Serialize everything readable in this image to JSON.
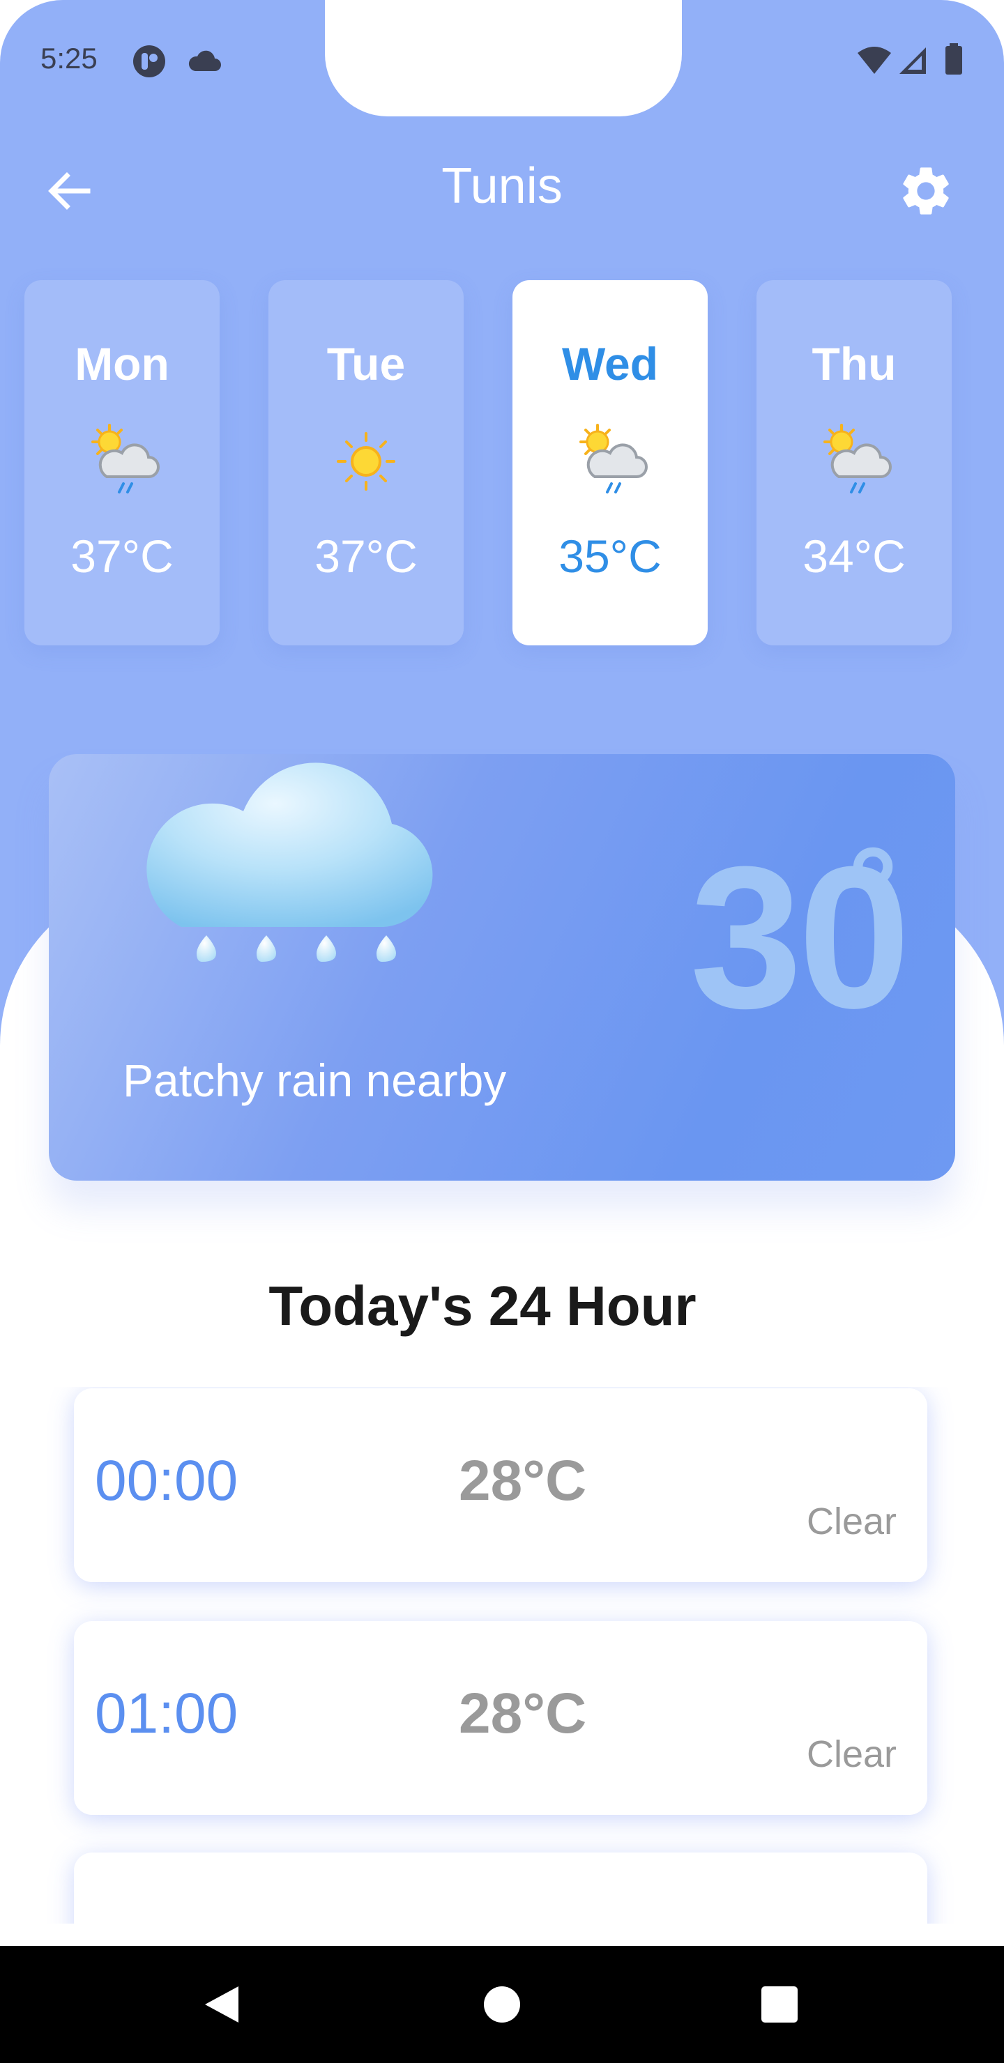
{
  "status_bar": {
    "time": "5:25",
    "left_icons": [
      "app-badge-icon",
      "cloud-icon"
    ],
    "right_icons": [
      "wifi-icon",
      "cellular-icon",
      "battery-icon"
    ]
  },
  "header": {
    "title": "Tunis",
    "back_icon": "arrow-left-icon",
    "settings_icon": "gear-icon"
  },
  "days": [
    {
      "day": "Mon",
      "temp": "37°C",
      "icon": "sun-cloud-rain-icon",
      "selected": false
    },
    {
      "day": "Tue",
      "temp": "37°C",
      "icon": "sun-icon",
      "selected": false
    },
    {
      "day": "Wed",
      "temp": "35°C",
      "icon": "sun-cloud-rain-icon",
      "selected": true
    },
    {
      "day": "Thu",
      "temp": "34°C",
      "icon": "sun-cloud-rain-icon",
      "selected": false
    }
  ],
  "current": {
    "temp": "30",
    "degree_symbol": "°",
    "condition": "Patchy rain nearby",
    "icon": "rain-cloud-icon"
  },
  "hourly": {
    "title": "Today's 24 Hour",
    "items": [
      {
        "time": "00:00",
        "temp": "28°C",
        "condition": "Clear",
        "icon": "moon-icon"
      },
      {
        "time": "01:00",
        "temp": "28°C",
        "condition": "Clear",
        "icon": "moon-icon"
      },
      {
        "time": "",
        "temp": "",
        "condition": "",
        "icon": "moon-icon"
      }
    ]
  },
  "colors": {
    "header_bg": "#92b0f8",
    "accent_blue": "#2f8ee6",
    "hour_time_blue": "#5b8ff0",
    "muted_gray": "#9a9a9a"
  },
  "nav_bar": {
    "icons": [
      "back-triangle-icon",
      "home-circle-icon",
      "recents-square-icon"
    ]
  }
}
